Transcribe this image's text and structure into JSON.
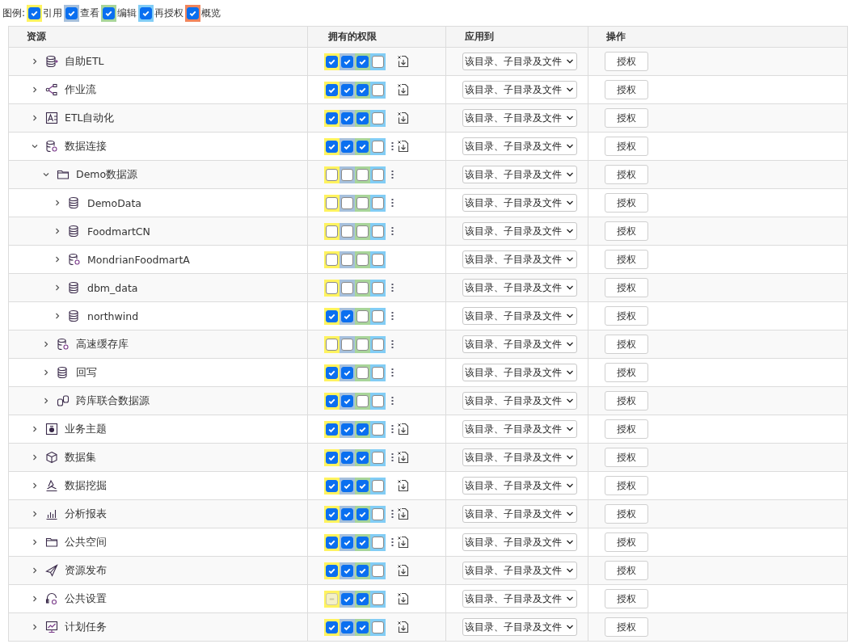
{
  "legend": {
    "label": "图例:",
    "items": [
      {
        "label": "引用",
        "color": "#fff35f",
        "checked": true
      },
      {
        "label": "查看",
        "color": "#a6c0dc",
        "checked": true
      },
      {
        "label": "编辑",
        "color": "#a8d59a",
        "checked": true
      },
      {
        "label": "再授权",
        "color": "#82cdf5",
        "checked": true
      },
      {
        "label": "概览",
        "color": "#f0855c",
        "checked": true
      }
    ]
  },
  "table": {
    "columns": [
      "资源",
      "拥有的权限",
      "应用到",
      "操作"
    ],
    "items": [
      {
        "name": "自助ETL",
        "kind": "etl",
        "expanded": false,
        "more": false,
        "import": true,
        "apply": "该目录、子目录及文件",
        "action": "授权",
        "perms": [
          {
            "checked": true,
            "partial": false
          },
          {
            "checked": true,
            "partial": false
          },
          {
            "checked": true,
            "partial": false
          },
          {
            "checked": false,
            "partial": false
          }
        ]
      },
      {
        "name": "作业流",
        "kind": "flow",
        "expanded": false,
        "more": false,
        "import": true,
        "apply": "该目录、子目录及文件",
        "action": "授权",
        "perms": [
          {
            "checked": true,
            "partial": false
          },
          {
            "checked": true,
            "partial": false
          },
          {
            "checked": true,
            "partial": false
          },
          {
            "checked": false,
            "partial": false
          }
        ]
      },
      {
        "name": "ETL自动化",
        "kind": "etl-auto",
        "expanded": false,
        "more": false,
        "import": true,
        "apply": "该目录、子目录及文件",
        "action": "授权",
        "perms": [
          {
            "checked": true,
            "partial": false
          },
          {
            "checked": true,
            "partial": false
          },
          {
            "checked": true,
            "partial": false
          },
          {
            "checked": false,
            "partial": false
          }
        ]
      },
      {
        "name": "数据连接",
        "kind": "db-gear",
        "expanded": true,
        "more": true,
        "import": true,
        "apply": "该目录、子目录及文件",
        "action": "授权",
        "perms": [
          {
            "checked": true,
            "partial": false
          },
          {
            "checked": true,
            "partial": false
          },
          {
            "checked": true,
            "partial": false
          },
          {
            "checked": false,
            "partial": false
          }
        ],
        "children": [
          {
            "name": "Demo数据源",
            "kind": "folder",
            "expanded": true,
            "more": true,
            "import": false,
            "apply": "该目录、子目录及文件",
            "action": "授权",
            "perms": [
              {
                "checked": false,
                "partial": false
              },
              {
                "checked": false,
                "partial": false
              },
              {
                "checked": false,
                "partial": false
              },
              {
                "checked": false,
                "partial": false
              }
            ],
            "children": [
              {
                "name": "DemoData",
                "kind": "database",
                "expanded": false,
                "more": true,
                "import": false,
                "apply": "该目录、子目录及文件",
                "action": "授权",
                "perms": [
                  {
                    "checked": false,
                    "partial": false
                  },
                  {
                    "checked": false,
                    "partial": false
                  },
                  {
                    "checked": false,
                    "partial": false
                  },
                  {
                    "checked": false,
                    "partial": false
                  }
                ]
              },
              {
                "name": "FoodmartCN",
                "kind": "database",
                "expanded": false,
                "more": true,
                "import": false,
                "apply": "该目录、子目录及文件",
                "action": "授权",
                "perms": [
                  {
                    "checked": false,
                    "partial": false
                  },
                  {
                    "checked": false,
                    "partial": false
                  },
                  {
                    "checked": false,
                    "partial": false
                  },
                  {
                    "checked": false,
                    "partial": false
                  }
                ]
              },
              {
                "name": "MondrianFoodmartA",
                "kind": "database-alt",
                "expanded": false,
                "more": false,
                "import": false,
                "apply": "该目录、子目录及文件",
                "action": "授权",
                "perms": [
                  {
                    "checked": false,
                    "partial": false
                  },
                  {
                    "checked": false,
                    "partial": false
                  },
                  {
                    "checked": false,
                    "partial": false
                  },
                  {
                    "checked": false,
                    "partial": false
                  }
                ]
              },
              {
                "name": "dbm_data",
                "kind": "database",
                "expanded": false,
                "more": true,
                "import": false,
                "apply": "该目录、子目录及文件",
                "action": "授权",
                "perms": [
                  {
                    "checked": false,
                    "partial": false
                  },
                  {
                    "checked": false,
                    "partial": false
                  },
                  {
                    "checked": false,
                    "partial": false
                  },
                  {
                    "checked": false,
                    "partial": false
                  }
                ]
              },
              {
                "name": "northwind",
                "kind": "database",
                "expanded": false,
                "more": true,
                "import": false,
                "apply": "该目录、子目录及文件",
                "action": "授权",
                "perms": [
                  {
                    "checked": true,
                    "partial": false
                  },
                  {
                    "checked": true,
                    "partial": false
                  },
                  {
                    "checked": false,
                    "partial": false
                  },
                  {
                    "checked": false,
                    "partial": false
                  }
                ]
              }
            ]
          },
          {
            "name": "高速缓存库",
            "kind": "database-alt",
            "expanded": false,
            "more": true,
            "import": false,
            "apply": "该目录、子目录及文件",
            "action": "授权",
            "perms": [
              {
                "checked": false,
                "partial": false
              },
              {
                "checked": false,
                "partial": false
              },
              {
                "checked": false,
                "partial": false
              },
              {
                "checked": false,
                "partial": false
              }
            ]
          },
          {
            "name": "回写",
            "kind": "database",
            "expanded": false,
            "more": true,
            "import": false,
            "apply": "该目录、子目录及文件",
            "action": "授权",
            "perms": [
              {
                "checked": true,
                "partial": false
              },
              {
                "checked": true,
                "partial": false
              },
              {
                "checked": false,
                "partial": false
              },
              {
                "checked": false,
                "partial": false
              }
            ]
          },
          {
            "name": "跨库联合数据源",
            "kind": "federated",
            "expanded": false,
            "more": true,
            "import": false,
            "apply": "该目录、子目录及文件",
            "action": "授权",
            "perms": [
              {
                "checked": true,
                "partial": false
              },
              {
                "checked": true,
                "partial": false
              },
              {
                "checked": false,
                "partial": false
              },
              {
                "checked": false,
                "partial": false
              }
            ]
          }
        ]
      },
      {
        "name": "业务主题",
        "kind": "subject",
        "expanded": false,
        "more": true,
        "import": true,
        "apply": "该目录、子目录及文件",
        "action": "授权",
        "perms": [
          {
            "checked": true,
            "partial": false
          },
          {
            "checked": true,
            "partial": false
          },
          {
            "checked": true,
            "partial": false
          },
          {
            "checked": false,
            "partial": false
          }
        ]
      },
      {
        "name": "数据集",
        "kind": "cube",
        "expanded": false,
        "more": true,
        "import": true,
        "apply": "该目录、子目录及文件",
        "action": "授权",
        "perms": [
          {
            "checked": true,
            "partial": false
          },
          {
            "checked": true,
            "partial": false
          },
          {
            "checked": true,
            "partial": false
          },
          {
            "checked": false,
            "partial": false
          }
        ]
      },
      {
        "name": "数据挖掘",
        "kind": "mining",
        "expanded": false,
        "more": false,
        "import": true,
        "apply": "该目录、子目录及文件",
        "action": "授权",
        "perms": [
          {
            "checked": true,
            "partial": false
          },
          {
            "checked": true,
            "partial": false
          },
          {
            "checked": true,
            "partial": false
          },
          {
            "checked": false,
            "partial": false
          }
        ]
      },
      {
        "name": "分析报表",
        "kind": "report",
        "expanded": false,
        "more": true,
        "import": true,
        "apply": "该目录、子目录及文件",
        "action": "授权",
        "perms": [
          {
            "checked": true,
            "partial": false
          },
          {
            "checked": true,
            "partial": false
          },
          {
            "checked": true,
            "partial": false
          },
          {
            "checked": false,
            "partial": false
          }
        ]
      },
      {
        "name": "公共空间",
        "kind": "folder",
        "expanded": false,
        "more": true,
        "import": true,
        "apply": "该目录、子目录及文件",
        "action": "授权",
        "perms": [
          {
            "checked": true,
            "partial": false
          },
          {
            "checked": true,
            "partial": false
          },
          {
            "checked": true,
            "partial": false
          },
          {
            "checked": false,
            "partial": false
          }
        ]
      },
      {
        "name": "资源发布",
        "kind": "publish",
        "expanded": false,
        "more": false,
        "import": true,
        "apply": "该目录、子目录及文件",
        "action": "授权",
        "perms": [
          {
            "checked": true,
            "partial": false
          },
          {
            "checked": true,
            "partial": false
          },
          {
            "checked": true,
            "partial": false
          },
          {
            "checked": false,
            "partial": false
          }
        ]
      },
      {
        "name": "公共设置",
        "kind": "settings",
        "expanded": false,
        "more": false,
        "import": true,
        "apply": "该目录、子目录及文件",
        "action": "授权",
        "perms": [
          {
            "checked": false,
            "partial": true
          },
          {
            "checked": true,
            "partial": false
          },
          {
            "checked": true,
            "partial": false
          },
          {
            "checked": false,
            "partial": false
          }
        ]
      },
      {
        "name": "计划任务",
        "kind": "schedule",
        "expanded": false,
        "more": false,
        "import": true,
        "apply": "该目录、子目录及文件",
        "action": "授权",
        "perms": [
          {
            "checked": true,
            "partial": false
          },
          {
            "checked": true,
            "partial": false
          },
          {
            "checked": true,
            "partial": false
          },
          {
            "checked": false,
            "partial": false
          }
        ]
      }
    ]
  }
}
